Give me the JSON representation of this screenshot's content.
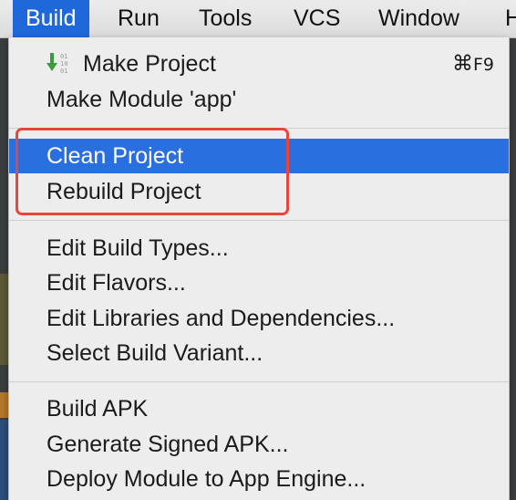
{
  "menubar": {
    "items": [
      "Build",
      "Run",
      "Tools",
      "VCS",
      "Window",
      "H"
    ],
    "active_index": 0
  },
  "build_menu": {
    "items": [
      {
        "label": "Make Project",
        "shortcut_symbol": "⌘",
        "shortcut_key": "F9",
        "icon": "make-binary-arrow-icon"
      },
      {
        "label": "Make Module 'app'"
      },
      {
        "label": "Clean Project",
        "highlighted": true
      },
      {
        "label": "Rebuild Project"
      },
      {
        "label": "Edit Build Types..."
      },
      {
        "label": "Edit Flavors..."
      },
      {
        "label": "Edit Libraries and Dependencies..."
      },
      {
        "label": "Select Build Variant..."
      },
      {
        "label": "Build APK"
      },
      {
        "label": "Generate Signed APK..."
      },
      {
        "label": "Deploy Module to App Engine..."
      }
    ]
  },
  "annotation": {
    "color": "#e8453c"
  },
  "colors": {
    "accent": "#2a6fe0",
    "menubar_active": "#1f68d9",
    "icon_arrow": "#3c9b3c"
  }
}
